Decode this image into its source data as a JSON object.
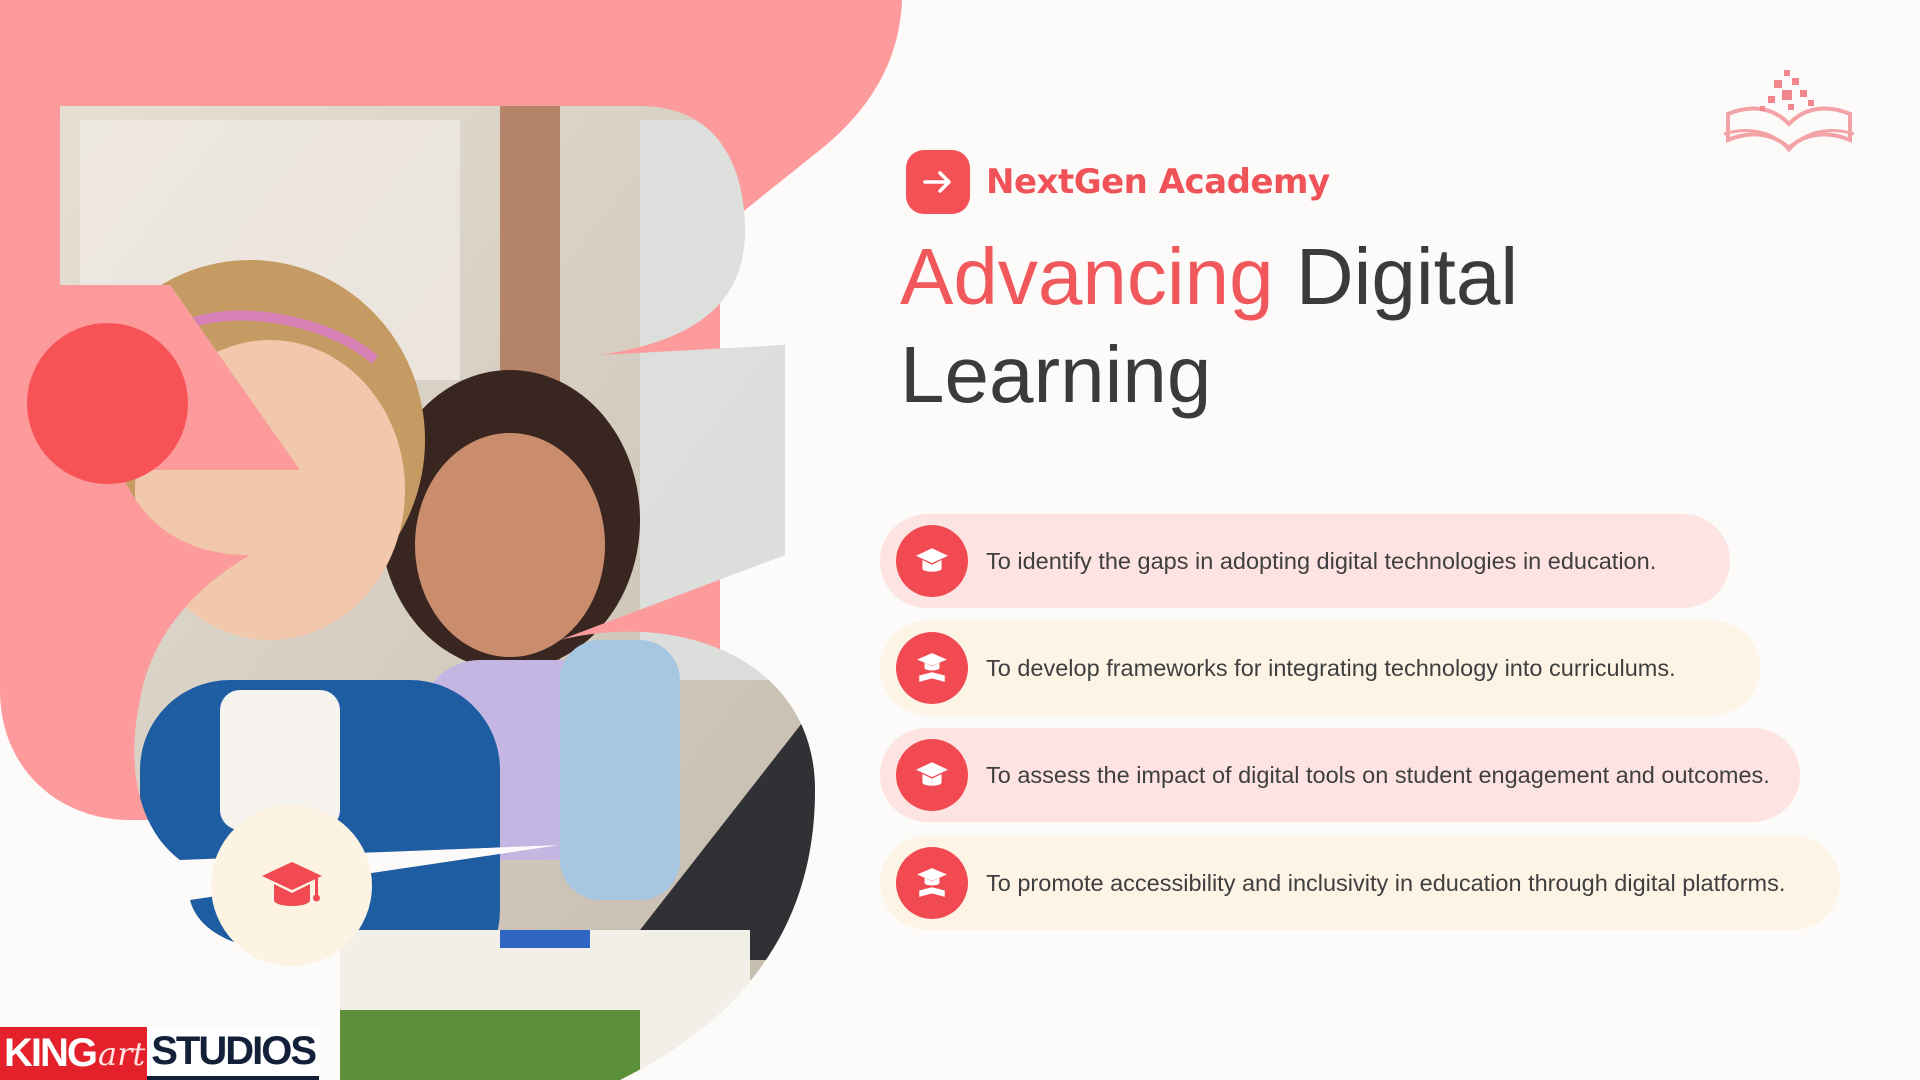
{
  "brand": {
    "name": "NextGen Academy",
    "arrow_icon": "arrow-right-icon"
  },
  "title": {
    "accent": "Advancing",
    "rest_line1": " Digital",
    "line2": "Learning"
  },
  "objectives": [
    {
      "text": "To identify the gaps in adopting digital technologies in education.",
      "icon": "graduation-cap-icon"
    },
    {
      "text": "To develop frameworks for integrating technology into curriculums.",
      "icon": "graduate-figure-icon"
    },
    {
      "text": "To assess the impact of digital tools on student engagement and outcomes.",
      "icon": "graduation-cap-icon"
    },
    {
      "text": "To promote accessibility and inclusivity in education through digital platforms.",
      "icon": "graduate-figure-icon"
    }
  ],
  "watermark": {
    "king": "KING",
    "art": "art",
    "studios": "STUDIOS"
  },
  "colors": {
    "accent_red": "#f24a52",
    "blob_pink": "#fc9a9c",
    "row_pink": "#fde3e1",
    "row_cream": "#fdf4e6",
    "text_dark": "#3b3b3b"
  }
}
